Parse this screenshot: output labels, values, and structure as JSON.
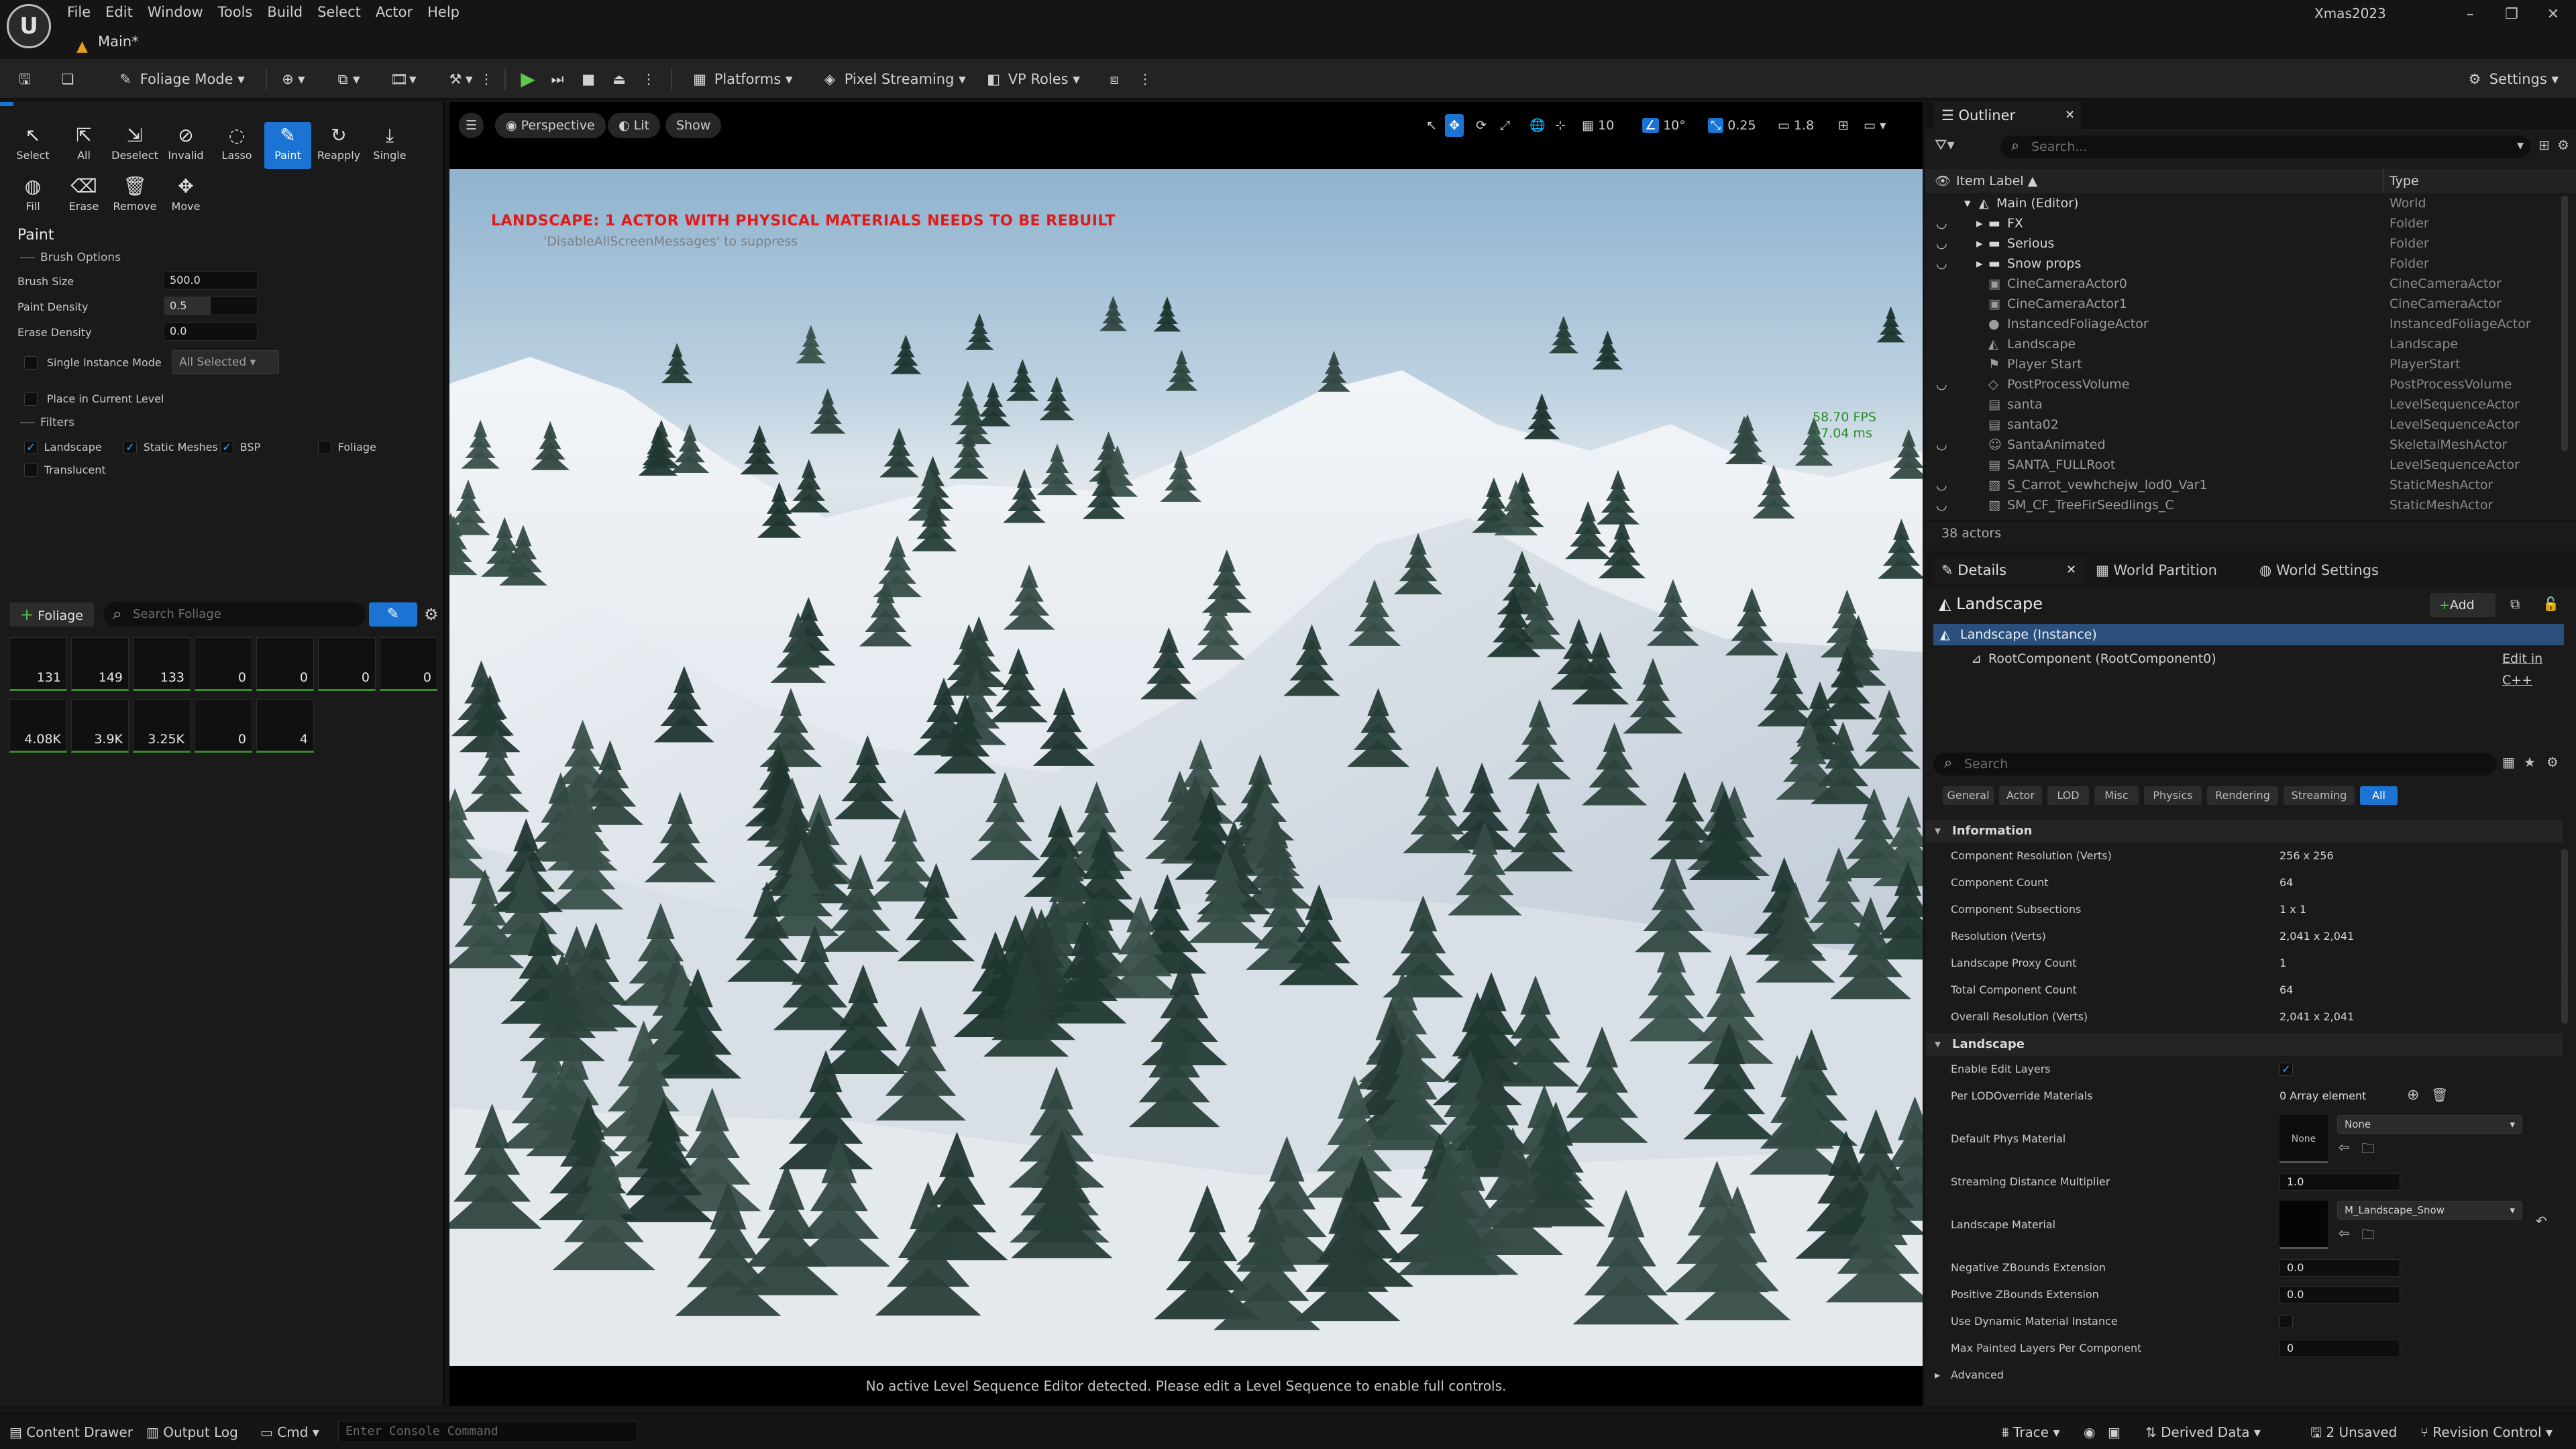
{
  "app": {
    "logo": "U",
    "menu": [
      "File",
      "Edit",
      "Window",
      "Tools",
      "Build",
      "Select",
      "Actor",
      "Help"
    ],
    "doc_tab": "Main*",
    "project": "Xmas2023"
  },
  "toolbar": {
    "mode": "Foliage Mode",
    "platforms": "Platforms",
    "pixel_streaming": "Pixel Streaming",
    "vp_roles": "VP Roles",
    "settings": "Settings"
  },
  "foliage": {
    "tools": [
      {
        "label": "Select",
        "icon": "cursor-icon"
      },
      {
        "label": "All",
        "icon": "select-all-icon"
      },
      {
        "label": "Deselect",
        "icon": "deselect-icon"
      },
      {
        "label": "Invalid",
        "icon": "invalid-icon"
      },
      {
        "label": "Lasso",
        "icon": "lasso-icon"
      },
      {
        "label": "Paint",
        "icon": "paint-brush-icon"
      },
      {
        "label": "Reapply",
        "icon": "reapply-icon"
      },
      {
        "label": "Single",
        "icon": "single-icon"
      },
      {
        "label": "Fill",
        "icon": "fill-icon"
      },
      {
        "label": "Erase",
        "icon": "eraser-icon"
      },
      {
        "label": "Remove",
        "icon": "trash-icon"
      },
      {
        "label": "Move",
        "icon": "move-icon"
      }
    ],
    "paint_title": "Paint",
    "brush_options": "Brush Options",
    "brush_size_label": "Brush Size",
    "brush_size": "500.0",
    "paint_density_label": "Paint Density",
    "paint_density": "0.5",
    "erase_density_label": "Erase Density",
    "erase_density": "0.0",
    "single_instance_label": "Single Instance Mode",
    "single_instance_value": "All Selected",
    "place_current_level": "Place in Current Level",
    "filters_title": "Filters",
    "filters": [
      {
        "label": "Landscape",
        "checked": true
      },
      {
        "label": "Static Meshes",
        "checked": true
      },
      {
        "label": "BSP",
        "checked": true
      },
      {
        "label": "Foliage",
        "checked": false
      },
      {
        "label": "Translucent",
        "checked": false
      }
    ],
    "add_button": "Foliage",
    "search_placeholder": "Search Foliage",
    "tiles": [
      "131",
      "149",
      "133",
      "0",
      "0",
      "0",
      "0",
      "4.08K",
      "3.9K",
      "3.25K",
      "0",
      "4"
    ]
  },
  "viewport": {
    "perspective": "Perspective",
    "lit": "Lit",
    "show": "Show",
    "grid_snap": "10",
    "rot_snap": "10°",
    "scale_snap": "0.25",
    "cam_speed": "1.8",
    "warning": "LANDSCAPE: 1 ACTOR WITH PHYSICAL MATERIALS NEEDS TO BE REBUILT",
    "warning_sub": "'DisableAllScreenMessages' to suppress",
    "fps": "58.70 FPS",
    "ms": "17.04 ms",
    "status": "No active Level Sequence Editor detected. Please edit a Level Sequence to enable full controls."
  },
  "outliner": {
    "tab": "Outliner",
    "search_placeholder": "Search...",
    "col_label": "Item Label ▲",
    "col_type": "Type",
    "rows": [
      {
        "label": "Main (Editor)",
        "type": "World",
        "indent": 0,
        "icon": "world-icon",
        "eye": false,
        "bright": true
      },
      {
        "label": "FX",
        "type": "Folder",
        "indent": 1,
        "icon": "folder-icon",
        "eye": true,
        "bright": true
      },
      {
        "label": "Serious",
        "type": "Folder",
        "indent": 1,
        "icon": "folder-icon",
        "eye": true,
        "bright": true
      },
      {
        "label": "Snow props",
        "type": "Folder",
        "indent": 1,
        "icon": "folder-icon",
        "eye": true,
        "bright": true
      },
      {
        "label": "CineCameraActor0",
        "type": "CineCameraActor",
        "indent": 2,
        "icon": "camera-icon",
        "eye": false,
        "bright": false
      },
      {
        "label": "CineCameraActor1",
        "type": "CineCameraActor",
        "indent": 2,
        "icon": "camera-icon",
        "eye": false,
        "bright": false
      },
      {
        "label": "InstancedFoliageActor",
        "type": "InstancedFoliageActor",
        "indent": 2,
        "icon": "actor-icon",
        "eye": false,
        "bright": false
      },
      {
        "label": "Landscape",
        "type": "Landscape",
        "indent": 2,
        "icon": "landscape-icon",
        "eye": false,
        "bright": false
      },
      {
        "label": "Player Start",
        "type": "PlayerStart",
        "indent": 2,
        "icon": "player-start-icon",
        "eye": false,
        "bright": false
      },
      {
        "label": "PostProcessVolume",
        "type": "PostProcessVolume",
        "indent": 2,
        "icon": "volume-icon",
        "eye": true,
        "bright": false
      },
      {
        "label": "santa",
        "type": "LevelSequenceActor",
        "indent": 2,
        "icon": "sequence-icon",
        "eye": false,
        "bright": false
      },
      {
        "label": "santa02",
        "type": "LevelSequenceActor",
        "indent": 2,
        "icon": "sequence-icon",
        "eye": false,
        "bright": false
      },
      {
        "label": "SantaAnimated",
        "type": "SkeletalMeshActor",
        "indent": 2,
        "icon": "skeletal-mesh-icon",
        "eye": true,
        "bright": false
      },
      {
        "label": "SANTA_FULLRoot",
        "type": "LevelSequenceActor",
        "indent": 2,
        "icon": "sequence-icon",
        "eye": false,
        "bright": false
      },
      {
        "label": "S_Carrot_vewhchejw_lod0_Var1",
        "type": "StaticMeshActor",
        "indent": 2,
        "icon": "static-mesh-icon",
        "eye": true,
        "bright": false
      },
      {
        "label": "SM_CF_TreeFirSeedlings_C",
        "type": "StaticMeshActor",
        "indent": 2,
        "icon": "static-mesh-icon",
        "eye": true,
        "bright": false
      }
    ],
    "count": "38 actors"
  },
  "details": {
    "tabs": [
      "Details",
      "World Partition",
      "World Settings"
    ],
    "object": "Landscape",
    "add_button": "Add",
    "instance": "Landscape (Instance)",
    "root_component": "RootComponent (RootComponent0)",
    "edit_cpp": "Edit in C++",
    "search_placeholder": "Search",
    "categories": [
      "General",
      "Actor",
      "LOD",
      "Misc",
      "Physics",
      "Rendering",
      "Streaming",
      "All"
    ],
    "info_title": "Information",
    "info": [
      {
        "k": "Component Resolution (Verts)",
        "v": "256 x 256"
      },
      {
        "k": "Component Count",
        "v": "64"
      },
      {
        "k": "Component Subsections",
        "v": "1 x 1"
      },
      {
        "k": "Resolution (Verts)",
        "v": "2,041 x 2,041"
      },
      {
        "k": "Landscape Proxy Count",
        "v": "1"
      },
      {
        "k": "Total Component Count",
        "v": "64"
      },
      {
        "k": "Overall Resolution (Verts)",
        "v": "2,041 x 2,041"
      }
    ],
    "landscape_title": "Landscape",
    "enable_edit_layers": "Enable Edit Layers",
    "per_lod": "Per LODOverride Materials",
    "per_lod_value": "0 Array element",
    "default_phys": "Default Phys Material",
    "default_phys_thumb": "None",
    "default_phys_value": "None",
    "streaming_mult": "Streaming Distance Multiplier",
    "streaming_mult_value": "1.0",
    "landscape_material": "Landscape Material",
    "landscape_material_value": "M_Landscape_Snow",
    "neg_z": "Negative ZBounds Extension",
    "neg_z_value": "0.0",
    "pos_z": "Positive ZBounds Extension",
    "pos_z_value": "0.0",
    "dyn_mat": "Use Dynamic Material Instance",
    "max_layers": "Max Painted Layers Per Component",
    "max_layers_value": "0",
    "advanced": "Advanced"
  },
  "statusbar": {
    "content_drawer": "Content Drawer",
    "output_log": "Output Log",
    "cmd": "Cmd",
    "console_placeholder": "Enter Console Command",
    "trace": "Trace",
    "derived_data": "Derived Data",
    "unsaved": "2 Unsaved",
    "revision": "Revision Control"
  }
}
